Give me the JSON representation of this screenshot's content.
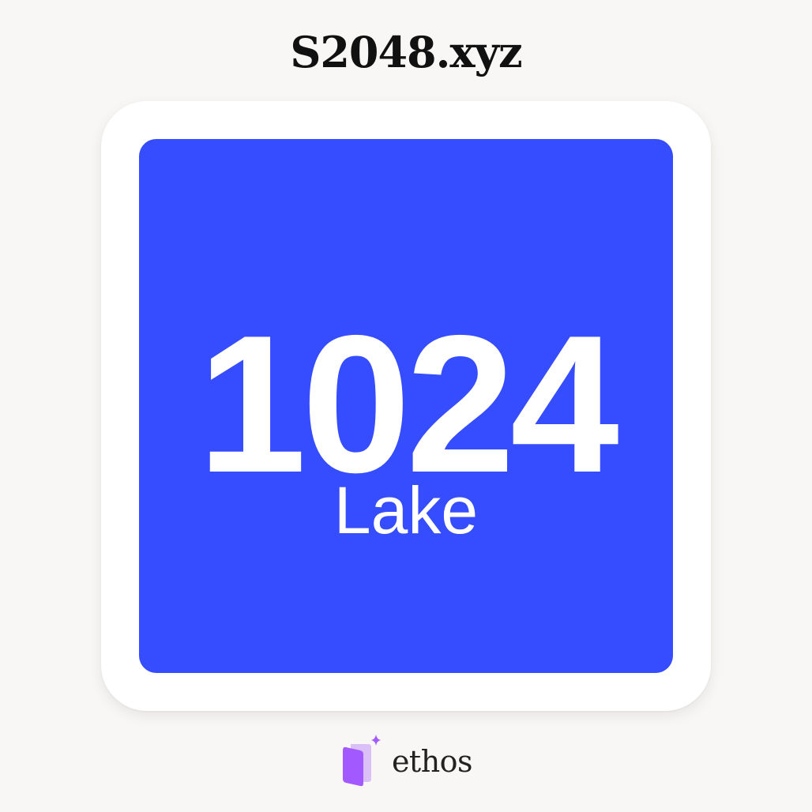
{
  "site": {
    "title": "S2048.xyz"
  },
  "tile": {
    "number": "1024",
    "label": "Lake",
    "color": "#354cff"
  },
  "brand": {
    "name": "ethos",
    "logo_icon": "book-sparkle-icon",
    "logo_color": "#a259ff"
  }
}
